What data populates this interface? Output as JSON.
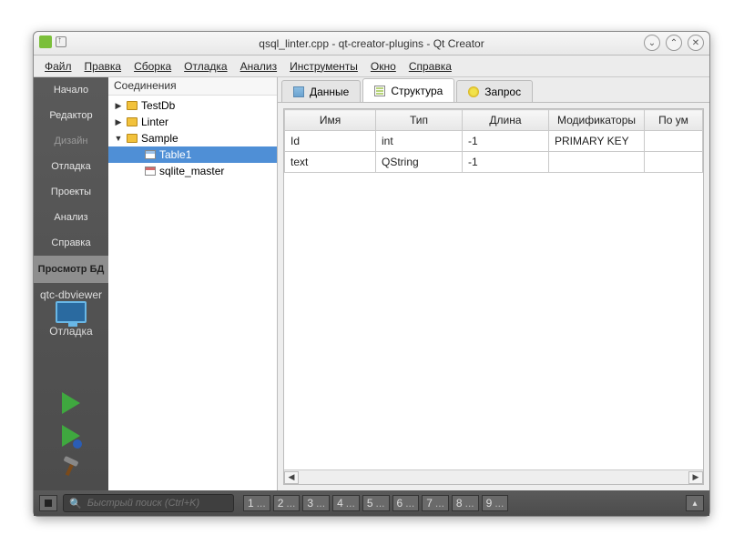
{
  "window": {
    "title": "qsql_linter.cpp - qt-creator-plugins - Qt Creator"
  },
  "menu": {
    "file": "Файл",
    "edit": "Правка",
    "build": "Сборка",
    "debug": "Отладка",
    "analyze": "Анализ",
    "tools": "Инструменты",
    "window": "Окно",
    "help": "Справка"
  },
  "modes": {
    "welcome": "Начало",
    "edit": "Редактор",
    "design": "Дизайн",
    "debug": "Отладка",
    "projects": "Проекты",
    "analyze": "Анализ",
    "help": "Справка",
    "dbview": "Просмотр БД"
  },
  "kit": {
    "name": "qtc-dbviewer",
    "config": "Отладка"
  },
  "tree": {
    "header": "Соединения",
    "nodes": [
      {
        "label": "TestDb",
        "expanded": false
      },
      {
        "label": "Linter",
        "expanded": false
      },
      {
        "label": "Sample",
        "expanded": true,
        "children": [
          {
            "label": "Table1",
            "selected": true
          },
          {
            "label": "sqlite_master"
          }
        ]
      }
    ]
  },
  "tabs": {
    "data": "Данные",
    "structure": "Структура",
    "query": "Запрос",
    "active": "structure"
  },
  "table": {
    "headers": [
      "Имя",
      "Тип",
      "Длина",
      "Модификаторы",
      "По ум"
    ],
    "rows": [
      {
        "name": "Id",
        "type": "int",
        "length": "-1",
        "mods": "PRIMARY KEY",
        "def": ""
      },
      {
        "name": "text",
        "type": "QString",
        "length": "-1",
        "mods": "",
        "def": ""
      }
    ]
  },
  "status": {
    "search_placeholder": "Быстрый поиск (Ctrl+K)",
    "outputs": [
      "1",
      "2",
      "3",
      "4",
      "5",
      "6",
      "7",
      "8",
      "9"
    ]
  }
}
